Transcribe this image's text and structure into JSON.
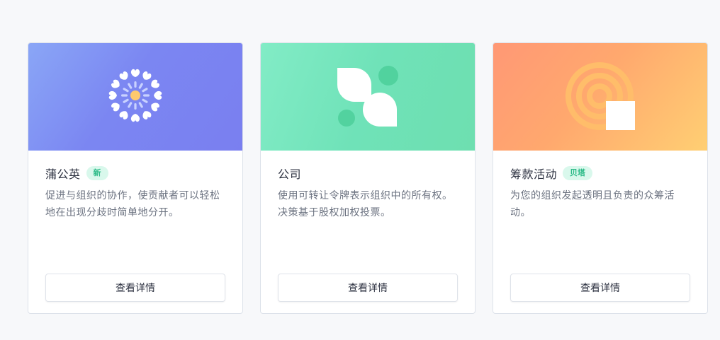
{
  "cards": [
    {
      "title": "蒲公英",
      "badge": "新",
      "description": "促进与组织的协作，使贡献者可以轻松地在出现分歧时简单地分开。",
      "button_label": "查看详情",
      "icon": "dandelion-icon"
    },
    {
      "title": "公司",
      "badge": "",
      "description": "使用可转让令牌表示组织中的所有权。决策基于股权加权投票。",
      "button_label": "查看详情",
      "icon": "company-leaves-icon"
    },
    {
      "title": "筹款活动",
      "badge": "贝塔",
      "description": "为您的组织发起透明且负责的众筹活动。",
      "button_label": "查看详情",
      "icon": "fundraising-signal-icon"
    }
  ],
  "colors": {
    "badge_bg": "#d9f8ec",
    "badge_text": "#2dbb88",
    "hero1": "#7b86f2",
    "hero2": "#6fe2b8",
    "hero3": "#ffa86e"
  }
}
